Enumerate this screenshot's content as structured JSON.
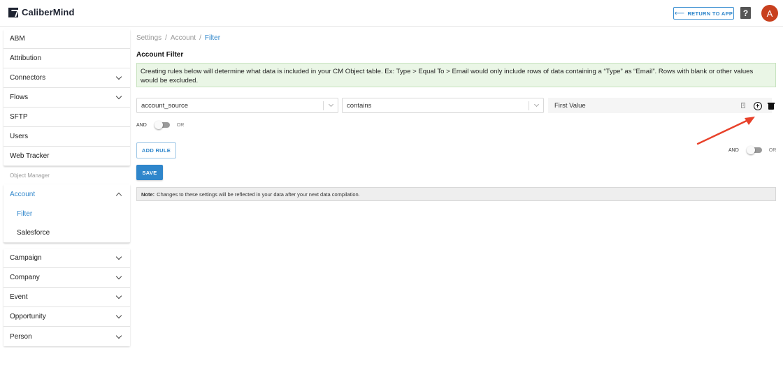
{
  "header": {
    "app_name": "CaliberMind",
    "return_label": "RETURN TO APP",
    "help_glyph": "?",
    "avatar_initial": "A"
  },
  "sidebar": {
    "top_items": [
      {
        "label": "ABM",
        "has_chevron": false
      },
      {
        "label": "Attribution",
        "has_chevron": false
      },
      {
        "label": "Connectors",
        "has_chevron": true
      },
      {
        "label": "Flows",
        "has_chevron": true
      },
      {
        "label": "SFTP",
        "has_chevron": false
      },
      {
        "label": "Users",
        "has_chevron": false
      },
      {
        "label": "Web Tracker",
        "has_chevron": false
      }
    ],
    "section_label": "Object Manager",
    "account": {
      "label": "Account",
      "expanded": true,
      "children": [
        "Filter",
        "Salesforce"
      ],
      "active_child": "Filter"
    },
    "objects": [
      "Campaign",
      "Company",
      "Event",
      "Opportunity",
      "Person"
    ]
  },
  "breadcrumb": [
    "Settings",
    "Account",
    "Filter"
  ],
  "page_title": "Account Filter",
  "info_text": "Creating rules below will determine what data is included in your CM Object table. Ex: Type > Equal To > Email would only include rows of data containing a “Type” as “Email”. Rows with blank or other values would be excluded.",
  "rule": {
    "field": "account_source",
    "operator": "contains",
    "value_placeholder": "First Value"
  },
  "inner_toggle": {
    "left": "AND",
    "right": "OR"
  },
  "outer_toggle": {
    "left": "AND",
    "right": "OR"
  },
  "add_rule_label": "ADD RULE",
  "save_label": "SAVE",
  "note": {
    "prefix": "Note:",
    "text": "Changes to these settings will be reflected in your data after your next data compilation."
  },
  "colors": {
    "accent": "#2f86cb",
    "avatar": "#c8401e",
    "info_bg": "#eaf6e6",
    "annotation_arrow": "#e8412a"
  },
  "icons": [
    "logo-icon",
    "return-arrow-icon",
    "help-icon",
    "chevron-down-icon",
    "chevron-up-icon",
    "number-icon",
    "add-circle-icon",
    "trash-icon"
  ]
}
